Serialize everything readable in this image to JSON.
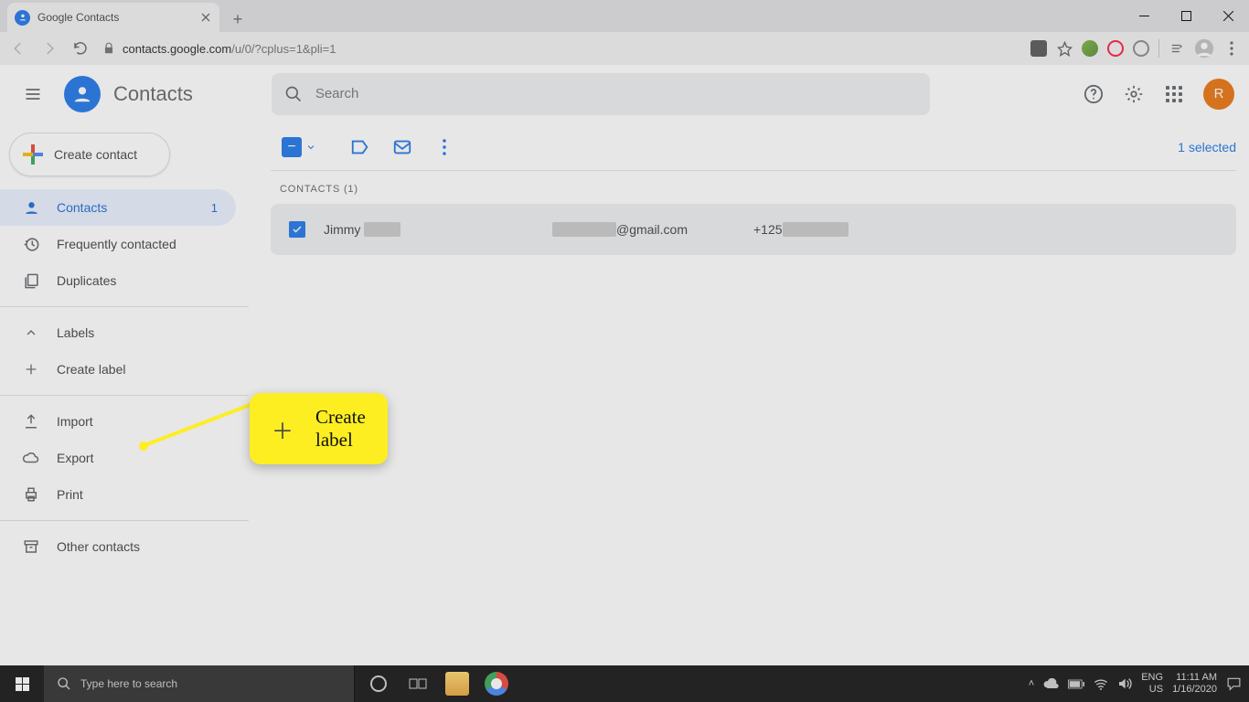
{
  "browser": {
    "tab_title": "Google Contacts",
    "url_domain": "contacts.google.com",
    "url_path": "/u/0/?cplus=1&pli=1"
  },
  "header": {
    "product_name": "Contacts",
    "search_placeholder": "Search",
    "avatar_initial": "R"
  },
  "sidebar": {
    "create_contact": "Create contact",
    "items": [
      {
        "icon": "person",
        "label": "Contacts",
        "count": "1",
        "active": true
      },
      {
        "icon": "history",
        "label": "Frequently contacted"
      },
      {
        "icon": "duplicate",
        "label": "Duplicates"
      }
    ],
    "labels_header": "Labels",
    "create_label": "Create label",
    "section3": [
      {
        "icon": "upload",
        "label": "Import"
      },
      {
        "icon": "cloud",
        "label": "Export"
      },
      {
        "icon": "print",
        "label": "Print"
      }
    ],
    "other_contacts": "Other contacts"
  },
  "toolbar": {
    "selected_text": "1 selected"
  },
  "list": {
    "section_header": "CONTACTS (1)",
    "rows": [
      {
        "name_visible": "Jimmy",
        "email_suffix": "@gmail.com",
        "phone_prefix": "+125"
      }
    ]
  },
  "callout": {
    "text": "Create label"
  },
  "taskbar": {
    "search_placeholder": "Type here to search",
    "lang1": "ENG",
    "lang2": "US",
    "time": "11:11 AM",
    "date": "1/16/2020"
  }
}
